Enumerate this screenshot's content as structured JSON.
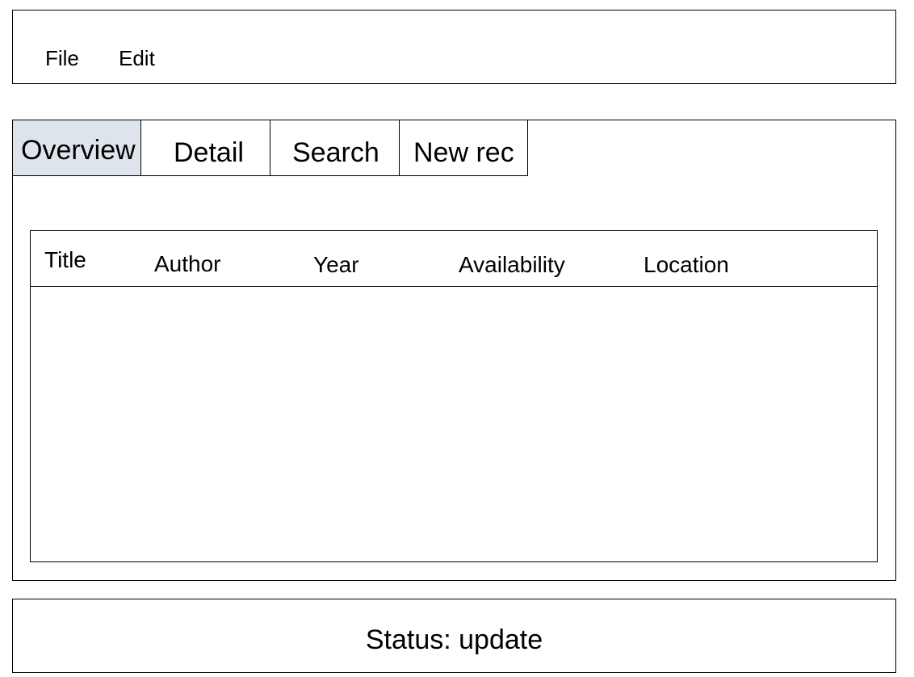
{
  "menu": {
    "items": [
      {
        "label": "File"
      },
      {
        "label": "Edit"
      }
    ]
  },
  "tabs": [
    {
      "label": "Overview",
      "active": true
    },
    {
      "label": "Detail",
      "active": false
    },
    {
      "label": "Search",
      "active": false
    },
    {
      "label": "New rec",
      "active": false
    }
  ],
  "table": {
    "columns": [
      "Title",
      "Author",
      "Year",
      "Availability",
      "Location"
    ],
    "rows": []
  },
  "status": {
    "text": "Status: update"
  },
  "colors": {
    "active_tab_bg": "#dde4ec",
    "border": "#000000",
    "background": "#ffffff"
  }
}
